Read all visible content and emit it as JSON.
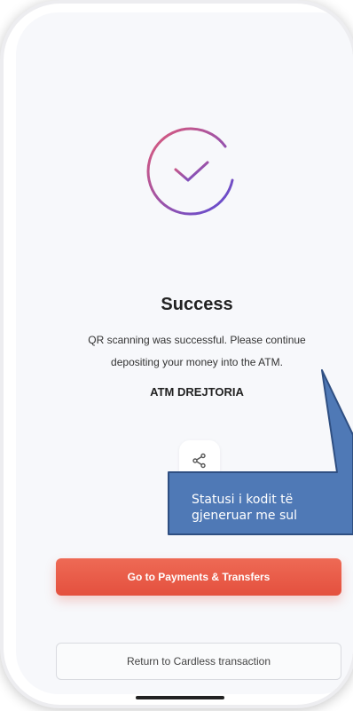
{
  "screen": {
    "title": "Success",
    "message": "QR scanning was successful.  Please continue depositing your money into the ATM.",
    "atm_name": "ATM DREJTORIA"
  },
  "buttons": {
    "primary_label": "Go to Payments & Transfers",
    "secondary_label": "Return to Cardless transaction"
  },
  "icons": {
    "status": "success-check-icon",
    "share": "share-icon"
  },
  "callout": {
    "line1": "Statusi i kodit të",
    "line2": "gjeneruar me sul"
  },
  "colors": {
    "primary_button": "#e4503e",
    "callout_fill": "#4f79b6",
    "check_gradient_start": "#e05a78",
    "check_gradient_end": "#5a4bd6"
  }
}
